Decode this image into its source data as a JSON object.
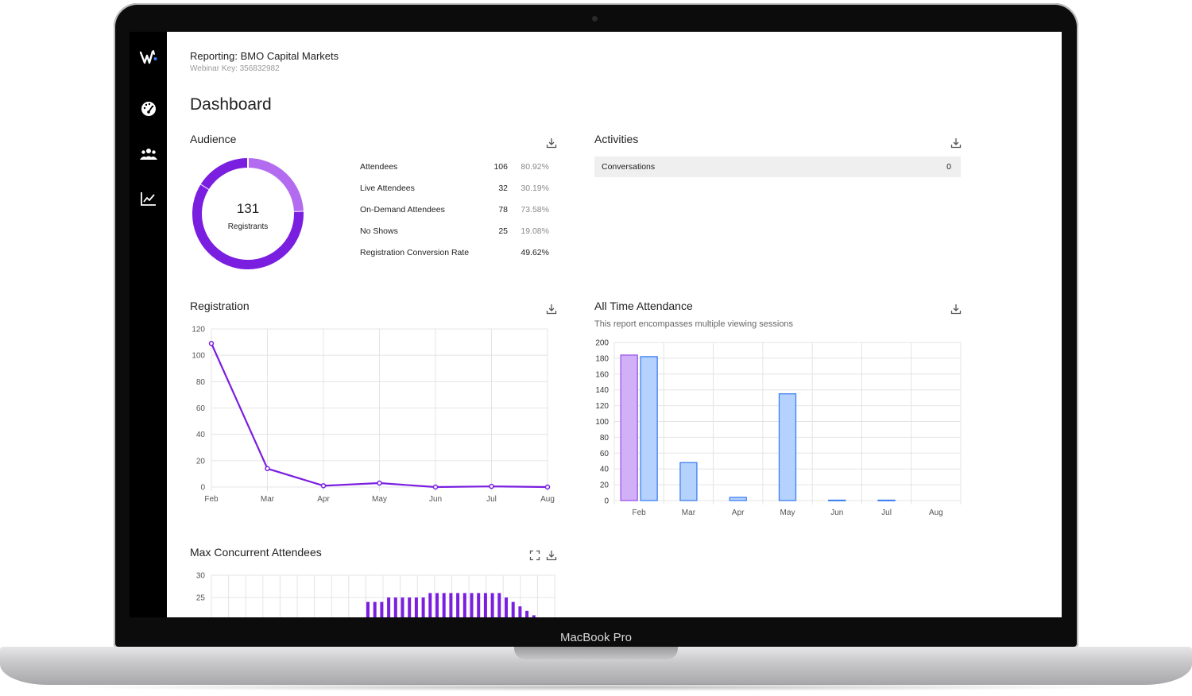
{
  "device": {
    "brand": "MacBook Pro"
  },
  "header": {
    "report_title": "Reporting: BMO Capital Markets",
    "webinar_key": "Webinar Key: 356832982",
    "page_title": "Dashboard"
  },
  "colors": {
    "purple": "#7a1ee0",
    "purple_light": "#b36cf0",
    "blue_bar": "#a9ccff",
    "blue_edge": "#3d7ff2"
  },
  "audience": {
    "title": "Audience",
    "registrants_count": "131",
    "registrants_label": "Registrants",
    "rows": [
      {
        "label": "Attendees",
        "count": "106",
        "pct": "80.92%"
      },
      {
        "label": "Live Attendees",
        "count": "32",
        "pct": "30.19%"
      },
      {
        "label": "On-Demand Attendees",
        "count": "78",
        "pct": "73.58%"
      },
      {
        "label": "No Shows",
        "count": "25",
        "pct": "19.08%"
      },
      {
        "label": "Registration Conversion Rate",
        "count": "",
        "pct": "49.62%"
      }
    ]
  },
  "activities": {
    "title": "Activities",
    "rows": [
      {
        "label": "Conversations",
        "value": "0"
      }
    ]
  },
  "registration": {
    "title": "Registration"
  },
  "all_time": {
    "title": "All Time Attendance",
    "subtitle": "This report encompasses multiple viewing sessions"
  },
  "max_concurrent": {
    "title": "Max Concurrent Attendees"
  },
  "chart_data": [
    {
      "type": "pie",
      "labels": [],
      "values": [
        32,
        78,
        21
      ],
      "colors": [
        "#b36cf0",
        "#7a1ee0",
        "#7a1ee0"
      ]
    },
    {
      "type": "line",
      "title": "Registration",
      "categories": [
        "Feb",
        "Mar",
        "Apr",
        "May",
        "Jun",
        "Jul",
        "Aug"
      ],
      "values": [
        109,
        14,
        1,
        3,
        0,
        0.5,
        0
      ],
      "ylim": [
        0,
        120
      ],
      "yticks": [
        0,
        20,
        40,
        60,
        80,
        100,
        120
      ],
      "grid": true
    },
    {
      "type": "bar",
      "title": "All Time Attendance",
      "categories": [
        "Feb",
        "Mar",
        "Apr",
        "May",
        "Jun",
        "Jul",
        "Aug"
      ],
      "series": [
        {
          "values": [
            184,
            0,
            0,
            0,
            0,
            0,
            0
          ],
          "color": "#c49cf5"
        },
        {
          "values": [
            182,
            48,
            4,
            135,
            0.5,
            0.5,
            0
          ],
          "color": "#a9ccff"
        }
      ],
      "ylim": [
        0,
        200
      ],
      "yticks": [
        0,
        20,
        40,
        60,
        80,
        100,
        120,
        140,
        160,
        180,
        200
      ],
      "grid": true
    },
    {
      "type": "bar",
      "title": "Max Concurrent Attendees",
      "yticks": [
        25,
        30
      ],
      "ylim": [
        20,
        30
      ],
      "values": [
        24,
        24,
        24,
        25,
        25,
        25,
        25,
        25,
        25,
        26,
        26,
        26,
        26,
        26,
        26,
        26,
        26,
        26,
        26,
        26,
        25,
        24,
        23,
        22,
        21
      ],
      "grid": true
    }
  ]
}
